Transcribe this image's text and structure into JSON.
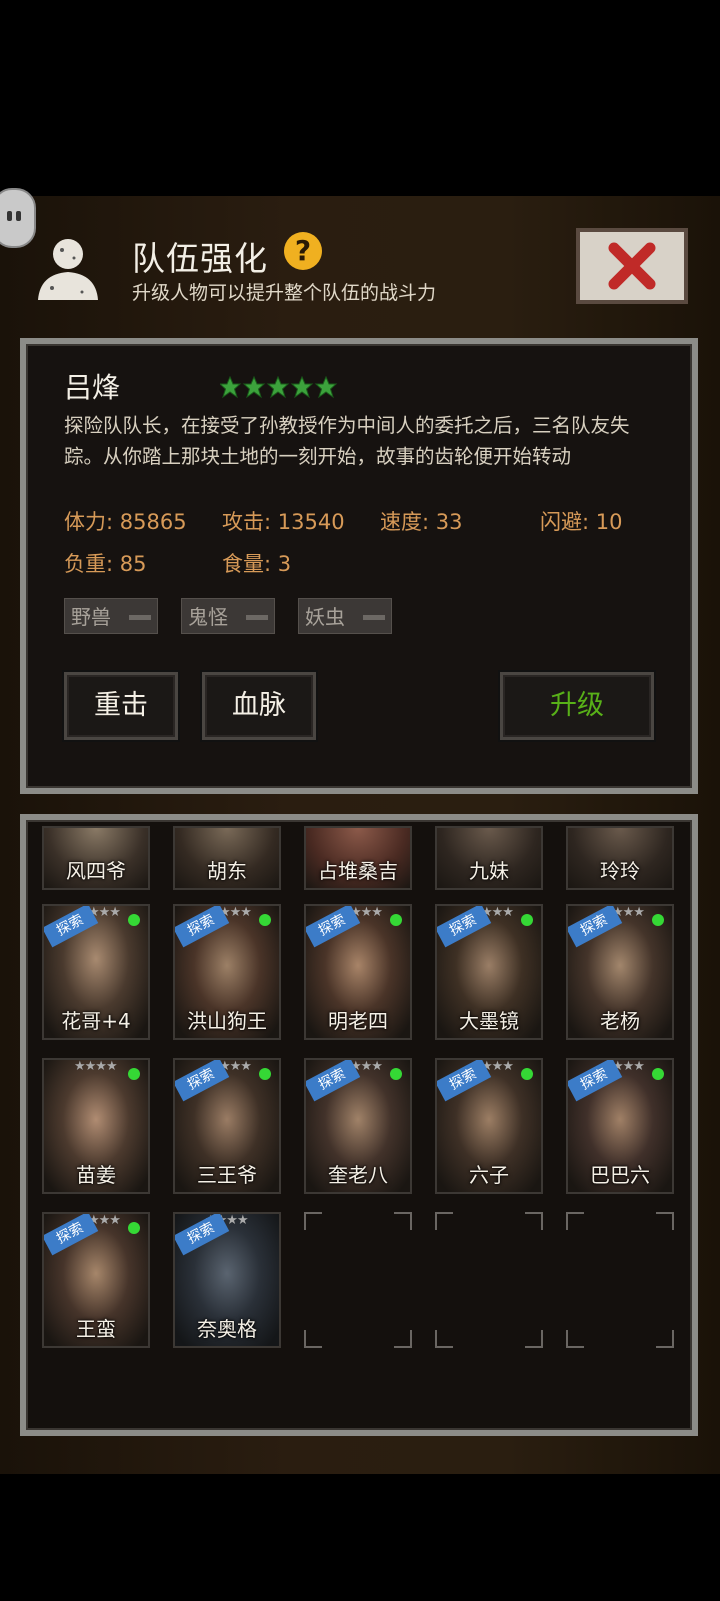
{
  "header": {
    "title": "队伍强化",
    "subtitle": "升级人物可以提升整个队伍的战斗力",
    "help_icon": "question-icon",
    "close_icon": "close-x-icon"
  },
  "character": {
    "name": "吕烽",
    "stars": 5,
    "description": "探险队队长，在接受了孙教授作为中间人的委托之后，三名队友失踪。从你踏上那块土地的一刻开始，故事的齿轮便开始转动",
    "stats": {
      "hp": "体力: 85865",
      "attack": "攻击: 13540",
      "speed": "速度: 33",
      "dodge": "闪避: 10",
      "load": "负重: 85",
      "food": "食量: 3"
    },
    "tags": [
      "野兽",
      "鬼怪",
      "妖虫"
    ]
  },
  "actions": {
    "heavy_strike": "重击",
    "bloodline": "血脉",
    "upgrade": "升级"
  },
  "roster": {
    "partial_row": [
      "风四爷",
      "胡东",
      "占堆桑吉",
      "九妹",
      "玲玲"
    ],
    "rows": [
      [
        {
          "name": "花哥+4",
          "explore": true,
          "badge_text": "探索"
        },
        {
          "name": "洪山狗王",
          "explore": true,
          "badge_text": "探索"
        },
        {
          "name": "明老四",
          "explore": true,
          "badge_text": "探索"
        },
        {
          "name": "大墨镜",
          "explore": true,
          "badge_text": "探索"
        },
        {
          "name": "老杨",
          "explore": true,
          "badge_text": "探索"
        }
      ],
      [
        {
          "name": "苗姜",
          "explore": false,
          "badge_text": ""
        },
        {
          "name": "三王爷",
          "explore": true,
          "badge_text": "探索"
        },
        {
          "name": "奎老八",
          "explore": true,
          "badge_text": "探索"
        },
        {
          "name": "六子",
          "explore": true,
          "badge_text": "探索"
        },
        {
          "name": "巴巴六",
          "explore": true,
          "badge_text": "探索"
        }
      ],
      [
        {
          "name": "王蛮",
          "explore": true,
          "badge_text": "探索"
        },
        {
          "name": "奈奥格",
          "explore": true,
          "badge_text": "探索"
        }
      ]
    ]
  },
  "colors": {
    "stat_text": "#d79a58",
    "upgrade_text": "#58b018",
    "explore_ribbon": "#3c7cc8",
    "online_dot": "#35d835",
    "help_icon_bg": "#f0b020"
  }
}
